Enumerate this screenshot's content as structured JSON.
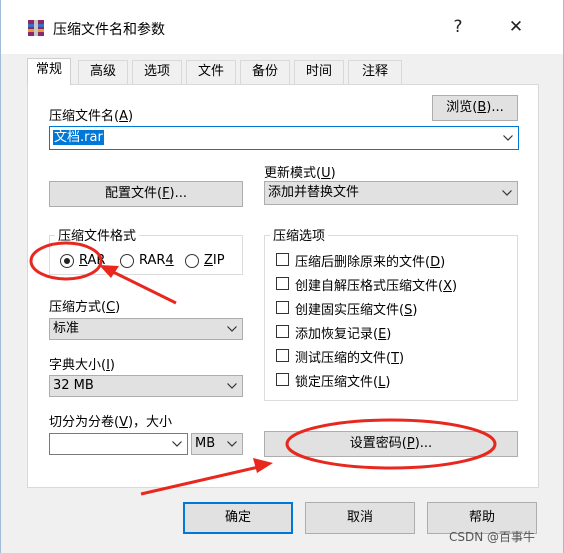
{
  "window": {
    "title": "压缩文件名和参数",
    "help_glyph": "?",
    "close_glyph": "✕"
  },
  "tabs": [
    {
      "label": "常规",
      "active": true
    },
    {
      "label": "高级",
      "active": false
    },
    {
      "label": "选项",
      "active": false
    },
    {
      "label": "文件",
      "active": false
    },
    {
      "label": "备份",
      "active": false
    },
    {
      "label": "时间",
      "active": false
    },
    {
      "label": "注释",
      "active": false
    }
  ],
  "archive_name": {
    "label": "压缩文件名(A)",
    "label_plain": "压缩文件名(",
    "label_key": "A",
    "label_tail": ")",
    "value": "文档.rar",
    "browse_label": "浏览(B)...",
    "browse_plain": "浏览(",
    "browse_key": "B",
    "browse_tail": ")..."
  },
  "profiles": {
    "label": "配置文件(F)...",
    "plain": "配置文件(",
    "key": "F",
    "tail": ")..."
  },
  "update_mode": {
    "label": "更新模式(U)",
    "plain": "更新模式(",
    "key": "U",
    "tail": ")",
    "value": "添加并替换文件"
  },
  "format": {
    "title": "压缩文件格式",
    "options": [
      {
        "label": "RAR",
        "key": "R",
        "rest": "AR",
        "selected": true
      },
      {
        "label": "RAR4",
        "pre": "RAR",
        "key": "4",
        "selected": false
      },
      {
        "label": "ZIP",
        "key": "Z",
        "rest": "IP",
        "selected": false
      }
    ]
  },
  "method": {
    "label": "压缩方式(C)",
    "plain": "压缩方式(",
    "key": "C",
    "tail": ")",
    "value": "标准"
  },
  "dictionary": {
    "label": "字典大小(I)",
    "plain": "字典大小(",
    "key": "I",
    "tail": ")",
    "value": "32 MB"
  },
  "split": {
    "label": "切分为分卷(V)，大小",
    "plain": "切分为分卷(",
    "key": "V",
    "tail": ")，大小",
    "value": "",
    "unit": "MB"
  },
  "options": {
    "title": "压缩选项",
    "items": [
      {
        "plain": "压缩后删除原来的文件(",
        "key": "D",
        "tail": ")",
        "checked": false
      },
      {
        "plain": "创建自解压格式压缩文件(",
        "key": "X",
        "tail": ")",
        "checked": false
      },
      {
        "plain": "创建固实压缩文件(",
        "key": "S",
        "tail": ")",
        "checked": false
      },
      {
        "plain": "添加恢复记录(",
        "key": "E",
        "tail": ")",
        "checked": false
      },
      {
        "plain": "测试压缩的文件(",
        "key": "T",
        "tail": ")",
        "checked": false
      },
      {
        "plain": "锁定压缩文件(",
        "key": "L",
        "tail": ")",
        "checked": false
      }
    ]
  },
  "password": {
    "plain": "设置密码(",
    "key": "P",
    "tail": ")..."
  },
  "footer": {
    "ok": "确定",
    "cancel": "取消",
    "help": "帮助"
  },
  "watermark": "CSDN @百事牛",
  "colors": {
    "annotation_red": "#e8281e",
    "selection_blue": "#0078d7"
  }
}
